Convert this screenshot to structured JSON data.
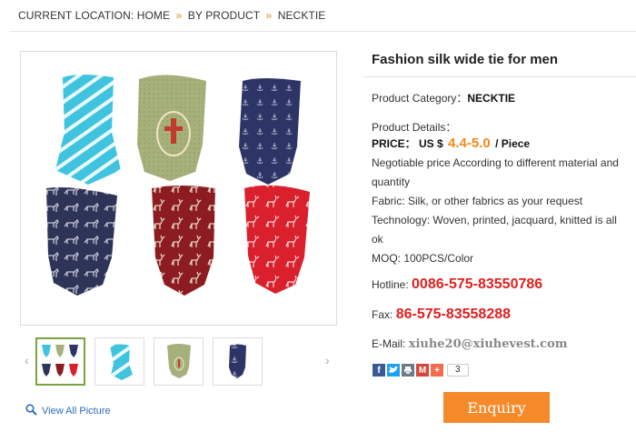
{
  "breadcrumb": {
    "label": "CURRENT LOCATION:",
    "items": [
      "HOME",
      "BY PRODUCT",
      "NECKTIE"
    ],
    "separator": "»"
  },
  "product": {
    "title": "Fashion silk wide tie for men",
    "category_label": "Product Category：",
    "category_value": "NECKTIE",
    "details_label": "Product Details：",
    "price_label": "PRICE：  US $",
    "price_value": "4.4-5.0",
    "price_unit": "/ Piece",
    "description_lines": [
      "Negotiable price According to different material and quantity",
      "Fabric: Silk, or other fabrics as your request",
      "Technology: Woven, printed, jacquard, knitted is all ok",
      "MOQ: 100PCS/Color"
    ],
    "hotline_label": "Hotline:",
    "hotline_value": "0086-575-83550786",
    "fax_label": "Fax:",
    "fax_value": "86-575-83558288",
    "email_label": "E-Mail:",
    "email_value": "xiuhe20@xiuhevest.com"
  },
  "gallery": {
    "prev_icon": "‹",
    "next_icon": "›",
    "view_all_label": "View All Picture",
    "thumbnails": [
      "all-ties",
      "light-blue-striped-tie",
      "olive-emblem-tie",
      "navy-anchor-tie"
    ],
    "active_thumbnail": 0
  },
  "share": {
    "count": "3",
    "icons": [
      "facebook-icon",
      "twitter-icon",
      "print-icon",
      "gmail-icon",
      "more-icon"
    ]
  },
  "enquiry_label": "Enquiry",
  "colors": {
    "accent_orange": "#f68a2a",
    "price_orange": "#f08a1c",
    "phone_red": "#e02020",
    "link_blue": "#2a6ebb",
    "thumb_active_green": "#7aa440"
  }
}
